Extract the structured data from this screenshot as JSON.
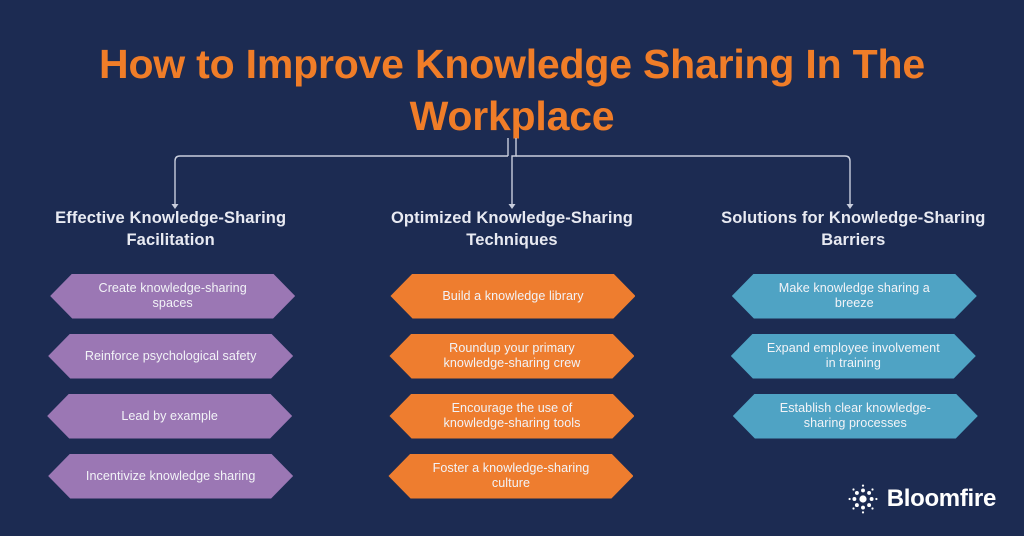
{
  "title": "How to Improve Knowledge Sharing In The Workplace",
  "colors": {
    "background": "#1c2b52",
    "title": "#f07d28",
    "heading": "#e8eaf2",
    "connector": "#c9cedd",
    "column_1": "#9b77b4",
    "column_2": "#ee7d2f",
    "column_3": "#4fa3c4",
    "logo": "#ffffff"
  },
  "columns": [
    {
      "heading": "Effective Knowledge-Sharing Facilitation",
      "items": [
        "Create knowledge-sharing spaces",
        "Reinforce psychological safety",
        "Lead by example",
        "Incentivize knowledge sharing"
      ]
    },
    {
      "heading": "Optimized Knowledge-Sharing Techniques",
      "items": [
        "Build a knowledge library",
        "Roundup your primary knowledge-sharing crew",
        "Encourage the use of knowledge-sharing tools",
        "Foster a knowledge-sharing culture"
      ]
    },
    {
      "heading": "Solutions for Knowledge-Sharing Barriers",
      "items": [
        "Make knowledge sharing a breeze",
        "Expand employee involvement in training",
        "Establish clear knowledge-sharing processes"
      ]
    }
  ],
  "logo": {
    "name": "Bloomfire",
    "mark": "bloomfire-starburst-icon"
  }
}
